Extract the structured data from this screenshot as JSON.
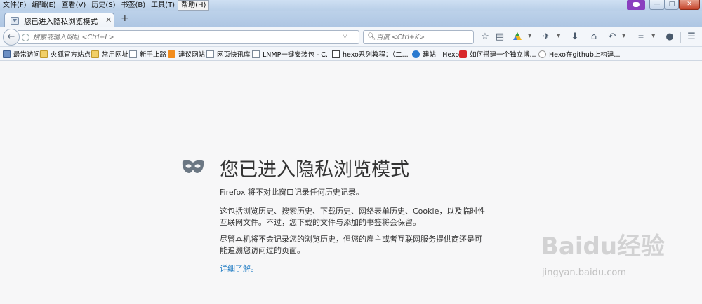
{
  "menubar": {
    "items": [
      "文件(F)",
      "编辑(E)",
      "查看(V)",
      "历史(S)",
      "书签(B)",
      "工具(T)",
      "帮助(H)"
    ]
  },
  "window_controls": {
    "minimize": "—",
    "maximize": "□",
    "close": "✕"
  },
  "tab": {
    "title": "您已进入隐私浏览模式",
    "close": "✕",
    "new_tab": "+"
  },
  "navbar": {
    "back": "←",
    "url_placeholder": "搜索或输入网址 <Ctrl+L>",
    "url_go": "→",
    "search_placeholder": "百度 <Ctrl+K>"
  },
  "toolbar_icons": [
    "star-icon",
    "reading-list-icon",
    "drive-icon",
    "extension-icon",
    "download-icon",
    "home-icon",
    "back-history-icon",
    "screenshot-icon",
    "chat-icon",
    "menu-icon"
  ],
  "bookmarks": [
    {
      "label": "最常访问",
      "icon": "folder"
    },
    {
      "label": "火狐官方站点",
      "icon": "folder"
    },
    {
      "label": "常用网址",
      "icon": "folder"
    },
    {
      "label": "新手上路",
      "icon": "page"
    },
    {
      "label": "建议网站",
      "icon": "orange"
    },
    {
      "label": "网页快讯库",
      "icon": "page"
    },
    {
      "label": "LNMP一键安装包 - C...",
      "icon": "page"
    },
    {
      "label": "hexo系列教程：（二...",
      "icon": "blog"
    },
    {
      "label": "建站 | Hexo",
      "icon": "hexo"
    },
    {
      "label": "如何搭建一个独立博...",
      "icon": "red"
    },
    {
      "label": "Hexo在github上构建...",
      "icon": "mail"
    }
  ],
  "private": {
    "title": "您已进入隐私浏览模式",
    "para1": "Firefox 将不对此窗口记录任何历史记录。",
    "para2": "这包括浏览历史、搜索历史、下载历史、网络表单历史、Cookie，以及临时性互联网文件。不过，您下载的文件与添加的书签将会保留。",
    "para3": "尽管本机将不会记录您的浏览历史，但您的雇主或者互联网服务提供商还是可能追溯您访问过的页面。",
    "learn_more": "详细了解。"
  },
  "watermark": {
    "logo": "Baidu经验",
    "url": "jingyan.baidu.com"
  },
  "colors": {
    "accent_link": "#1e7bc3",
    "private_badge": "#8a3fbf",
    "close_button": "#c5442b"
  }
}
